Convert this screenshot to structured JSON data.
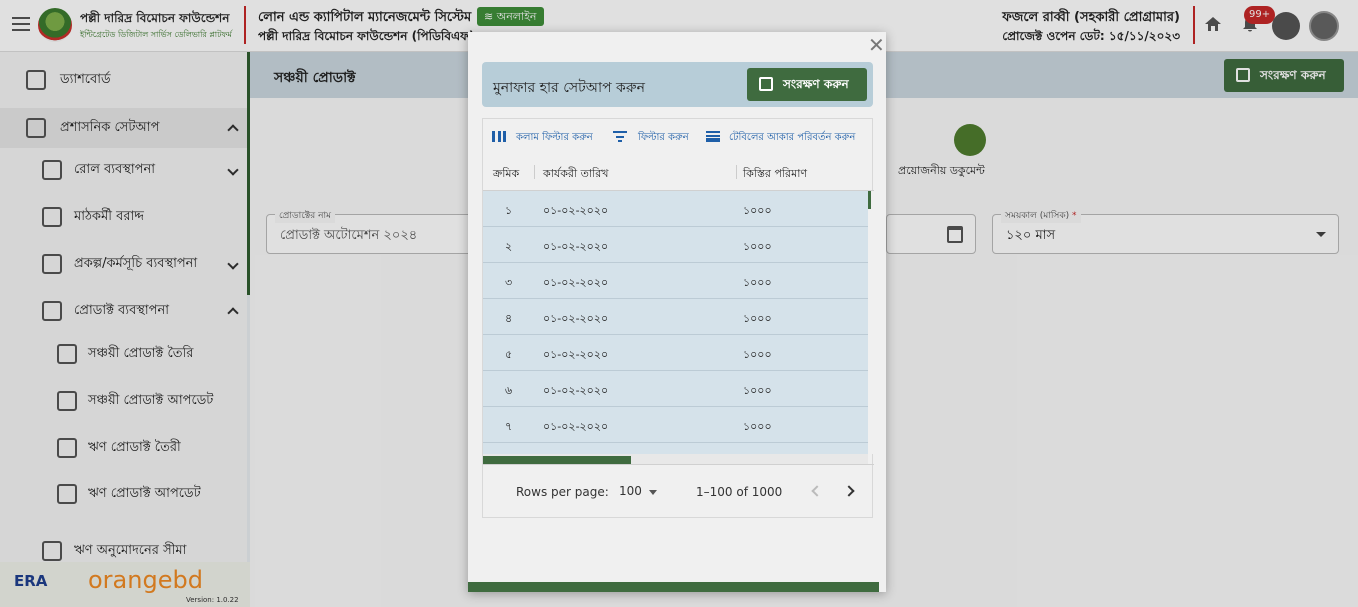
{
  "header": {
    "org_name": "পল্লী দারিদ্র বিমোচন ফাউন্ডেশন",
    "org_sub": "ইন্টিগ্রেটেড ডিজিটাল সার্ভিস ডেলিভারি প্লাটফর্ম",
    "system_title": "লোন এন্ড ক্যাপিটাল ম্যানেজমেন্ট সিস্টেম",
    "system_sub": "পল্লী দারিদ্র বিমোচন ফাউন্ডেশন (পিডিবিএফ)",
    "online_label": "অনলাইন",
    "user_name": "ফজলে রাব্বী (সহকারী প্রোগ্রামার)",
    "project_open_date": "প্রোজেক্ট ওপেন ডেট: ১৫/১১/২০২৩",
    "notification_count": "99+"
  },
  "sidebar": {
    "items": [
      {
        "label": "ড্যাশবোর্ড",
        "icon": "dashboard-icon"
      },
      {
        "label": "প্রশাসনিক সেটআপ",
        "icon": "admin-setup-icon",
        "expanded": true
      },
      {
        "label": "রোল ব্যবস্থাপনা",
        "icon": "role-icon",
        "expanded": false
      },
      {
        "label": "মাঠকর্মী বরাদ্দ",
        "icon": "field-worker-icon"
      },
      {
        "label": "প্রকল্প/কর্মসূচি ব্যবস্থাপনা",
        "icon": "project-icon",
        "expanded": false
      },
      {
        "label": "প্রোডাক্ট ব্যবস্থাপনা",
        "icon": "product-icon",
        "expanded": true
      },
      {
        "label": "সঞ্চয়ী প্রোডাক্ট তৈরি",
        "icon": "savings-create-icon"
      },
      {
        "label": "সঞ্চয়ী প্রোডাক্ট আপডেট",
        "icon": "savings-update-icon"
      },
      {
        "label": "ঋণ প্রোডাক্ট তৈরী",
        "icon": "loan-create-icon"
      },
      {
        "label": "ঋণ প্রোডাক্ট আপডেট",
        "icon": "loan-update-icon"
      },
      {
        "label": "ঋণ অনুমোদনের সীমা",
        "icon": "loan-limit-icon"
      }
    ],
    "footer": {
      "era": "ERA",
      "brand": "orangebd",
      "version": "Version: 1.0.22"
    }
  },
  "main": {
    "page_title": "সঞ্চয়ী প্রোডাক্ট",
    "save_label": "সংরক্ষণ করুন",
    "step_label": "প্রয়োজনীয় ডকুমেন্ট",
    "product_name": {
      "label": "প্রোডাক্টের নাম",
      "value": "প্রোডাক্ট অটোমেশন ২০২৪"
    },
    "duration": {
      "label": "সময়কাল (মাসিক)",
      "required_mark": "*",
      "value": "১২০ মাস"
    }
  },
  "dialog": {
    "title": "মুনাফার হার সেটআপ করুন",
    "save_label": "সংরক্ষণ করুন",
    "toolbar": {
      "columns": "কলাম ফিল্টার করুন",
      "filter": "ফিল্টার করুন",
      "density": "টেবিলের আকার পরিবর্তন করুন"
    },
    "columns": [
      "ক্রমিক",
      "কার্যকরী তারিখ",
      "কিস্তির পরিমাণ"
    ],
    "rows": [
      [
        "১",
        "০১-০২-২০২০",
        "১০০০"
      ],
      [
        "২",
        "০১-০২-২০২০",
        "১০০০"
      ],
      [
        "৩",
        "০১-০২-২০২০",
        "১০০০"
      ],
      [
        "৪",
        "০১-০২-২০২০",
        "১০০০"
      ],
      [
        "৫",
        "০১-০২-২০২০",
        "১০০০"
      ],
      [
        "৬",
        "০১-০২-২০২০",
        "১০০০"
      ],
      [
        "৭",
        "০১-০২-২০২০",
        "১০০০"
      ]
    ],
    "pagination": {
      "rows_per_page_label": "Rows per page:",
      "rows_per_page": "100",
      "range": "1–100 of 1000"
    }
  }
}
